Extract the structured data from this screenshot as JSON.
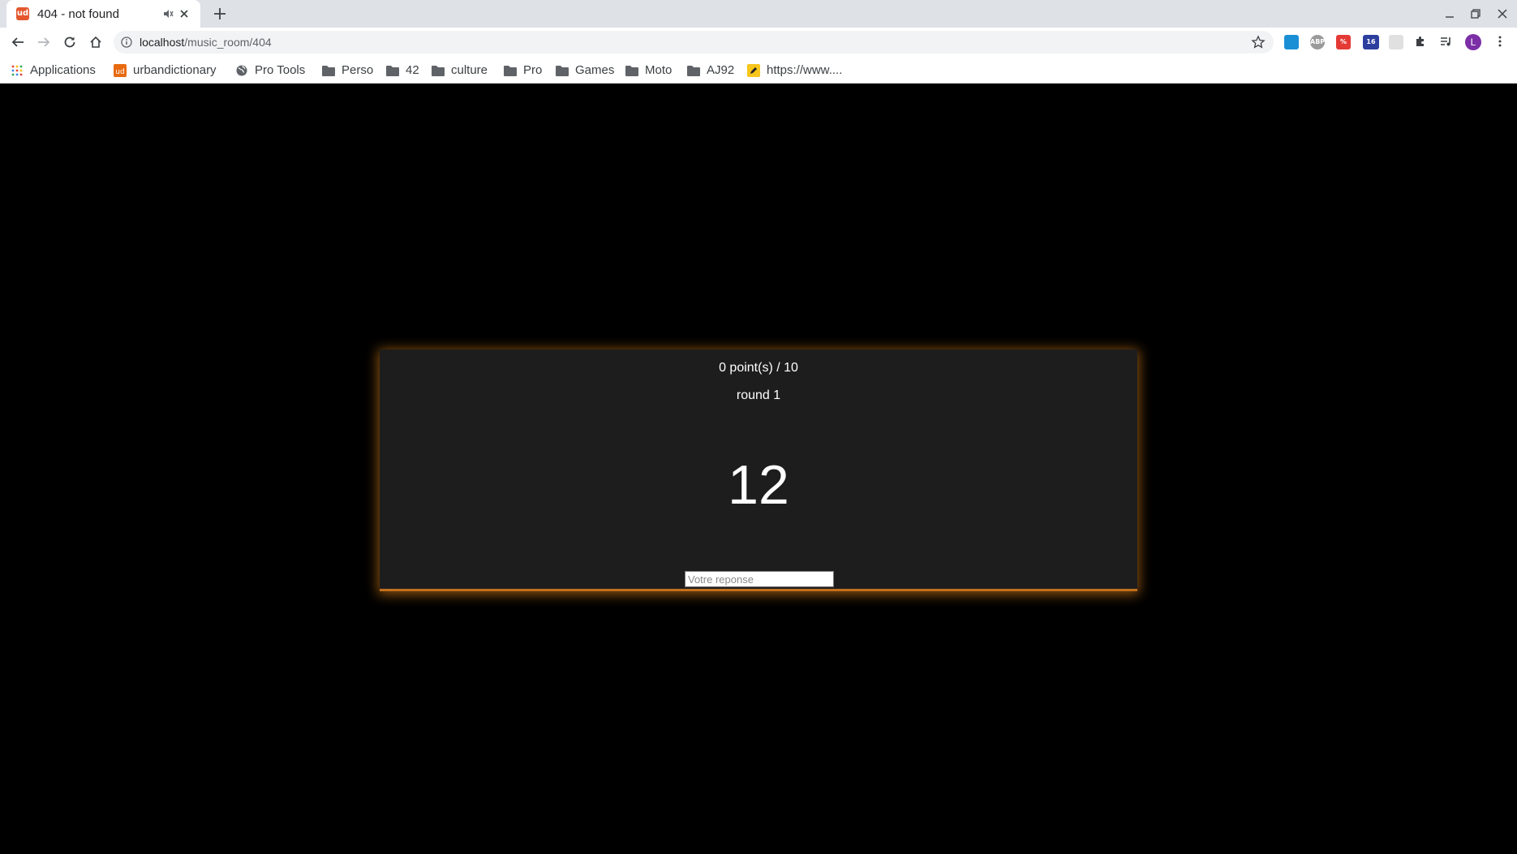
{
  "browser": {
    "tab_title": "404 - not found",
    "favicon_text": "ud",
    "url_host": "localhost",
    "url_path": "/music_room/404",
    "extension_badge": "16",
    "avatar_letter": "L",
    "bookmarks": [
      {
        "label": "Applications",
        "icon": "apps-grid-icon"
      },
      {
        "label": "urbandictionary",
        "icon": "urbandictionary-icon"
      },
      {
        "label": "Pro Tools",
        "icon": "globe-icon"
      },
      {
        "label": "Perso",
        "icon": "folder-icon"
      },
      {
        "label": "42",
        "icon": "folder-icon"
      },
      {
        "label": "culture",
        "icon": "folder-icon"
      },
      {
        "label": "Pro",
        "icon": "folder-icon"
      },
      {
        "label": "Games",
        "icon": "folder-icon"
      },
      {
        "label": "Moto",
        "icon": "folder-icon"
      },
      {
        "label": "AJ92",
        "icon": "folder-icon"
      },
      {
        "label": "https://www....",
        "icon": "pencil-icon"
      }
    ]
  },
  "game": {
    "score": "0 point(s) / 10",
    "round": "round 1",
    "timer": "12",
    "answer_placeholder": "Votre reponse",
    "answer_value": ""
  },
  "colors": {
    "page_background": "#000000",
    "card_background": "#1d1d1d",
    "card_glow": "#ff961e"
  }
}
